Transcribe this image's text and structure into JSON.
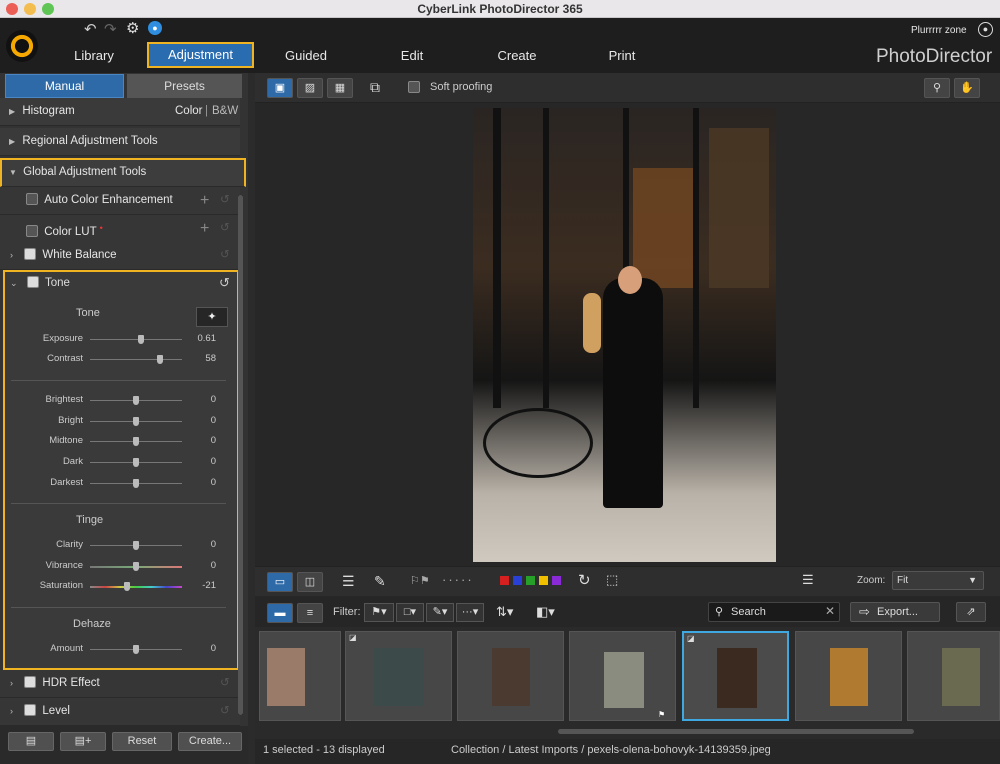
{
  "app": {
    "title": "CyberLink PhotoDirector 365",
    "brand": "PhotoDirector",
    "user": "Plurrrrr zone"
  },
  "nav": {
    "tabs": [
      "Library",
      "Adjustment",
      "Guided",
      "Edit",
      "Create",
      "Print"
    ],
    "active": "Adjustment"
  },
  "leftpanel": {
    "tabs": [
      "Manual",
      "Presets"
    ],
    "histogram": {
      "label": "Histogram",
      "color": "Color",
      "bw": "B&W"
    },
    "regional": "Regional Adjustment Tools",
    "global": "Global Adjustment Tools",
    "auto_color": "Auto Color Enhancement",
    "color_lut": "Color LUT",
    "white_balance": "White Balance",
    "tone_section": "Tone",
    "tone": {
      "heading": "Tone",
      "exposure": {
        "label": "Exposure",
        "value": "0.61"
      },
      "contrast": {
        "label": "Contrast",
        "value": "58"
      }
    },
    "range": [
      {
        "label": "Brightest",
        "value": "0"
      },
      {
        "label": "Bright",
        "value": "0"
      },
      {
        "label": "Midtone",
        "value": "0"
      },
      {
        "label": "Dark",
        "value": "0"
      },
      {
        "label": "Darkest",
        "value": "0"
      }
    ],
    "tinge": {
      "heading": "Tinge",
      "clarity": {
        "label": "Clarity",
        "value": "0"
      },
      "vibrance": {
        "label": "Vibrance",
        "value": "0"
      },
      "saturation": {
        "label": "Saturation",
        "value": "-21"
      }
    },
    "dehaze": {
      "heading": "Dehaze",
      "amount": {
        "label": "Amount",
        "value": "0"
      }
    },
    "hdr": "HDR Effect",
    "level": "Level",
    "footer": {
      "reset": "Reset",
      "create": "Create..."
    }
  },
  "main": {
    "soft_proofing": "Soft proofing",
    "zoom_label": "Zoom:",
    "zoom_value": "Fit",
    "filter_label": "Filter:",
    "search_placeholder": "Search",
    "export": "Export...",
    "status_left": "1 selected - 13 displayed",
    "status_path": "Collection / Latest Imports / pexels-olena-bohovyk-14139359.jpeg",
    "color_labels": [
      "#d62020",
      "#2a3fd6",
      "#27a02a",
      "#f0c000",
      "#8a2ad6"
    ],
    "accent": "#f0b322",
    "selected_border": "#3fa8e0"
  }
}
